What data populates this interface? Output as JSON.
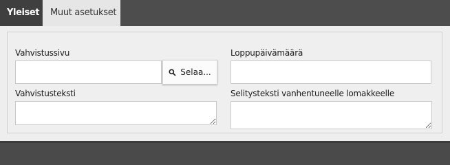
{
  "tabs": [
    {
      "label": "Yleiset",
      "active": true
    },
    {
      "label": "Muut asetukset",
      "active": false
    }
  ],
  "form": {
    "confirmation_page": {
      "label": "Vahvistussivu",
      "value": "",
      "browse_label": "Selaa...",
      "browse_icon": "search-icon"
    },
    "end_date": {
      "label": "Loppupäivämäärä",
      "value": ""
    },
    "confirmation_text": {
      "label": "Vahvistusteksti",
      "value": ""
    },
    "expired_form_text": {
      "label": "Selitysteksti vanhentuneelle lomakkeelle",
      "value": ""
    }
  },
  "colors": {
    "tabbar": "#4d4d4d",
    "active_tab": "#3f3f3f",
    "inactive_tab": "#e6e6e6",
    "panel": "#eeeeee"
  }
}
